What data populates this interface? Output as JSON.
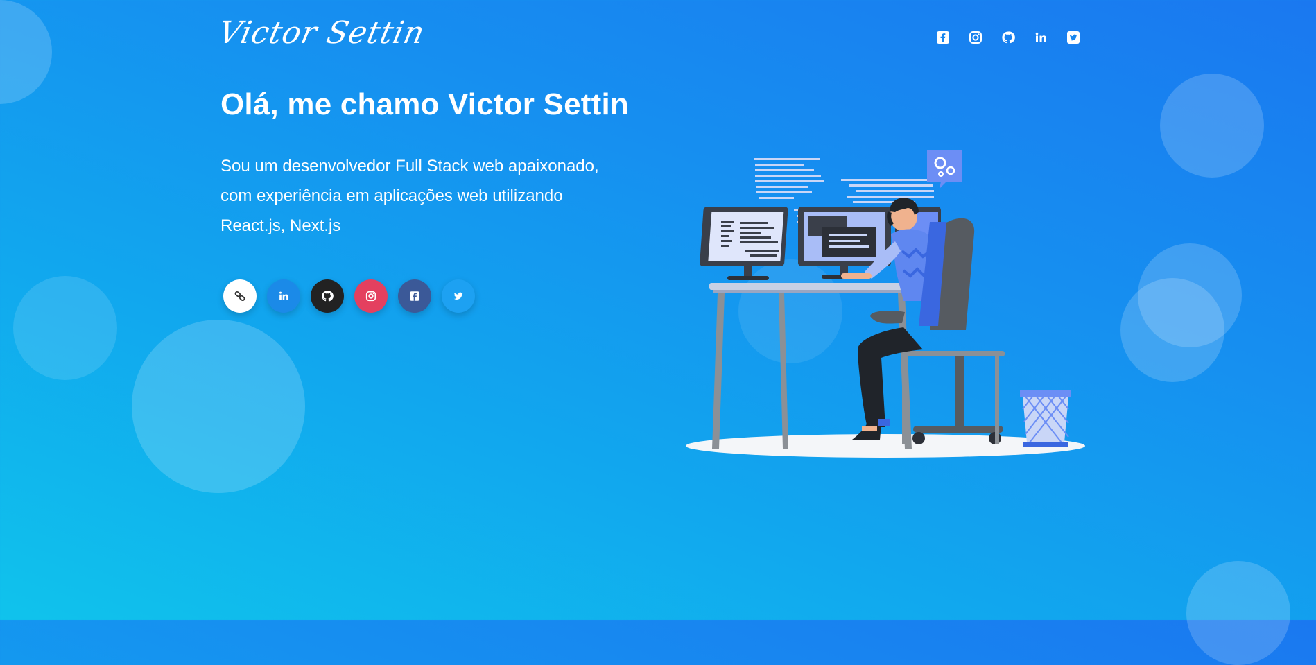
{
  "header": {
    "logo_text": "Victor Settin",
    "social_icons": [
      {
        "name": "facebook-icon",
        "label": "Facebook"
      },
      {
        "name": "instagram-icon",
        "label": "Instagram"
      },
      {
        "name": "github-icon",
        "label": "GitHub"
      },
      {
        "name": "linkedin-icon",
        "label": "LinkedIn"
      },
      {
        "name": "twitter-icon",
        "label": "Twitter"
      }
    ]
  },
  "hero": {
    "title": "Olá, me chamo Victor Settin",
    "description": "Sou um desenvolvedor Full Stack web apaixonado, com experiência em aplicações web utilizando React.js, Next.js",
    "social_buttons": [
      {
        "name": "link-button",
        "icon": "link-icon",
        "color": "#ffffff"
      },
      {
        "name": "linkedin-button",
        "icon": "linkedin-icon",
        "color": "#1b8ae8"
      },
      {
        "name": "github-button",
        "icon": "github-icon",
        "color": "#222222"
      },
      {
        "name": "instagram-button",
        "icon": "instagram-icon",
        "color": "#e4405f"
      },
      {
        "name": "facebook-button",
        "icon": "facebook-icon",
        "color": "#3b5998"
      },
      {
        "name": "twitter-button",
        "icon": "twitter-icon",
        "color": "#1da1f2"
      }
    ]
  },
  "illustration": {
    "icon": "developer-at-desk-illustration"
  },
  "colors": {
    "background_start": "#1a78f0",
    "background_end": "#10c3ec",
    "text": "#ffffff"
  }
}
